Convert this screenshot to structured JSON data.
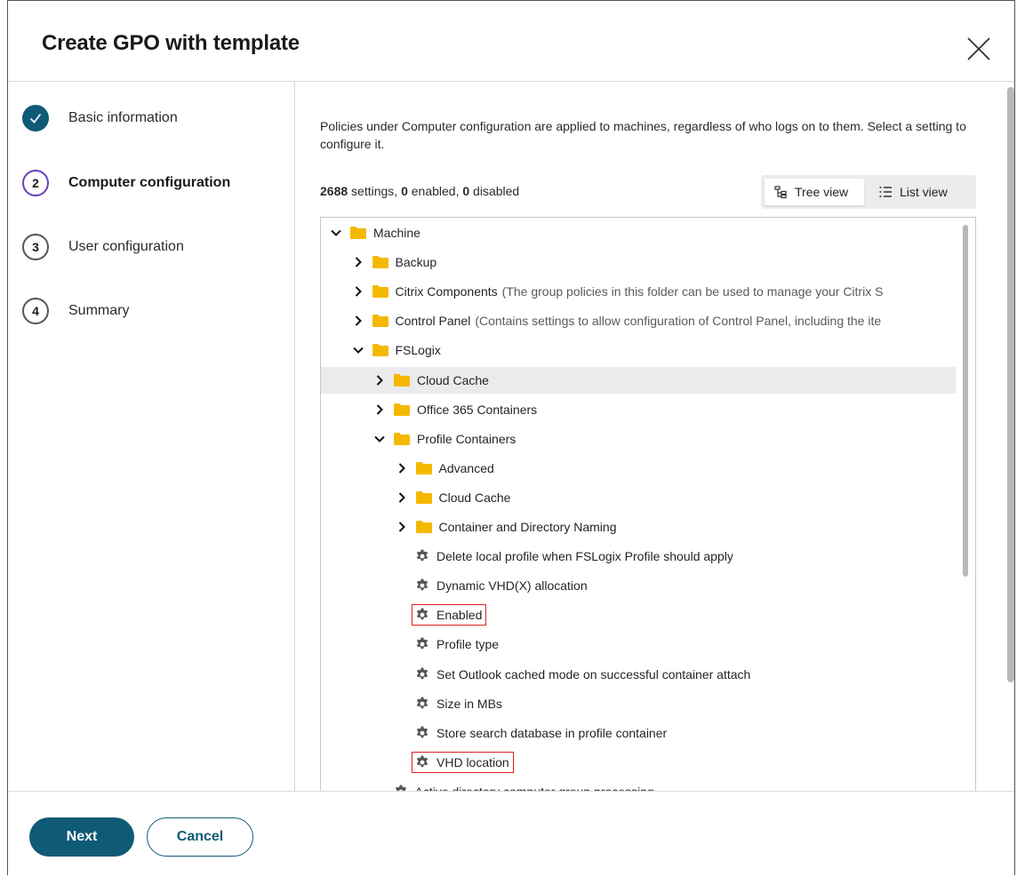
{
  "dialog": {
    "title": "Create GPO with template"
  },
  "steps": [
    {
      "num": "",
      "label": "Basic information",
      "state": "done"
    },
    {
      "num": "2",
      "label": "Computer configuration",
      "state": "active"
    },
    {
      "num": "3",
      "label": "User configuration",
      "state": "todo"
    },
    {
      "num": "4",
      "label": "Summary",
      "state": "todo"
    }
  ],
  "content": {
    "description": "Policies under Computer configuration are applied to machines, regardless of who logs on to them. Select a setting to configure it.",
    "counts": {
      "settings": "2688",
      "settings_label": " settings, ",
      "enabled": "0",
      "enabled_label": " enabled, ",
      "disabled": "0",
      "disabled_label": " disabled"
    },
    "view_toggle": {
      "tree_label": "Tree view",
      "list_label": "List view",
      "selected": "Tree view"
    }
  },
  "tree": {
    "rows": [
      {
        "kind": "folder",
        "expanded": true,
        "depth": 0,
        "label": "Machine",
        "desc": ""
      },
      {
        "kind": "folder",
        "expanded": false,
        "depth": 1,
        "label": "Backup",
        "desc": ""
      },
      {
        "kind": "folder",
        "expanded": false,
        "depth": 1,
        "label": "Citrix Components",
        "desc": "(The group policies in this folder can be used to manage your Citrix S"
      },
      {
        "kind": "folder",
        "expanded": false,
        "depth": 1,
        "label": "Control Panel",
        "desc": "(Contains settings to allow configuration of Control Panel, including the ite"
      },
      {
        "kind": "folder",
        "expanded": true,
        "depth": 1,
        "label": "FSLogix",
        "desc": ""
      },
      {
        "kind": "folder",
        "expanded": false,
        "depth": 2,
        "label": "Cloud Cache",
        "desc": "",
        "selected": true
      },
      {
        "kind": "folder",
        "expanded": false,
        "depth": 2,
        "label": "Office 365 Containers",
        "desc": ""
      },
      {
        "kind": "folder",
        "expanded": true,
        "depth": 2,
        "label": "Profile Containers",
        "desc": ""
      },
      {
        "kind": "folder",
        "expanded": false,
        "depth": 3,
        "label": "Advanced",
        "desc": ""
      },
      {
        "kind": "folder",
        "expanded": false,
        "depth": 3,
        "label": "Cloud Cache",
        "desc": ""
      },
      {
        "kind": "folder",
        "expanded": false,
        "depth": 3,
        "label": "Container and Directory Naming",
        "desc": ""
      },
      {
        "kind": "setting",
        "depth": 4,
        "label": "Delete local profile when FSLogix Profile should apply"
      },
      {
        "kind": "setting",
        "depth": 4,
        "label": "Dynamic VHD(X) allocation"
      },
      {
        "kind": "setting",
        "depth": 4,
        "label": "Enabled",
        "highlight": true
      },
      {
        "kind": "setting",
        "depth": 4,
        "label": "Profile type"
      },
      {
        "kind": "setting",
        "depth": 4,
        "label": "Set Outlook cached mode on successful container attach"
      },
      {
        "kind": "setting",
        "depth": 4,
        "label": "Size in MBs"
      },
      {
        "kind": "setting",
        "depth": 4,
        "label": "Store search database in profile container"
      },
      {
        "kind": "setting",
        "depth": 4,
        "label": "VHD location",
        "highlight": true
      },
      {
        "kind": "setting",
        "depth": 3,
        "label": "Active directory computer group processing"
      }
    ]
  },
  "footer": {
    "next_label": "Next",
    "cancel_label": "Cancel"
  },
  "colors": {
    "primary": "#0f5a75",
    "active_step": "#6a3fb8",
    "highlight_border": "#e02020",
    "folder": "#f5b800"
  }
}
